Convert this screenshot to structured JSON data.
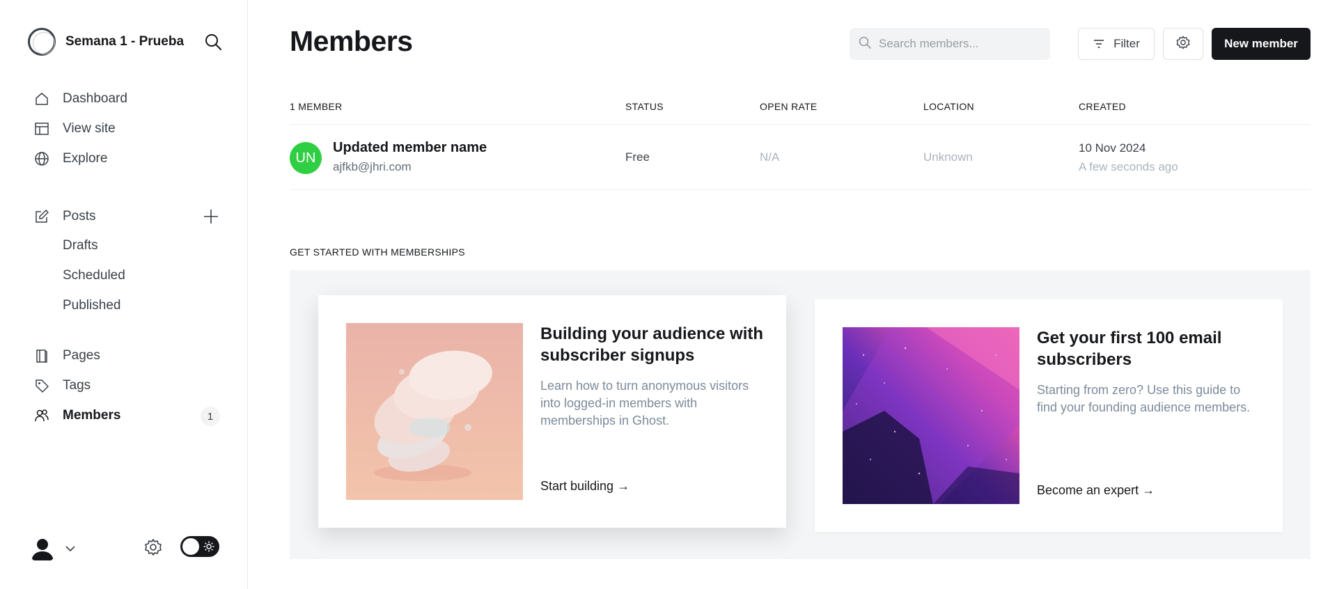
{
  "sidebar": {
    "site_title": "Semana 1 - Prueba",
    "nav": [
      {
        "label": "Dashboard",
        "icon": "home-icon"
      },
      {
        "label": "View site",
        "icon": "layout-icon"
      },
      {
        "label": "Explore",
        "icon": "globe-icon"
      }
    ],
    "posts": {
      "label": "Posts",
      "sub": [
        "Drafts",
        "Scheduled",
        "Published"
      ]
    },
    "nav2": [
      {
        "label": "Pages",
        "icon": "page-icon"
      },
      {
        "label": "Tags",
        "icon": "tag-icon"
      },
      {
        "label": "Members",
        "icon": "members-icon",
        "count": "1",
        "active": true
      }
    ]
  },
  "header": {
    "title": "Members",
    "search_placeholder": "Search members...",
    "filter_label": "Filter",
    "new_member_label": "New member"
  },
  "table": {
    "columns": [
      "1 member",
      "Status",
      "Open rate",
      "Location",
      "Created"
    ],
    "rows": [
      {
        "initials": "UN",
        "name": "Updated member name",
        "email": "ajfkb@jhri.com",
        "status": "Free",
        "open_rate": "N/A",
        "location": "Unknown",
        "created_date": "10 Nov 2024",
        "created_ago": "A few seconds ago"
      }
    ]
  },
  "get_started": {
    "label": "GET STARTED WITH MEMBERSHIPS",
    "cards": [
      {
        "title": "Building your audience with subscriber signups",
        "description": "Learn how to turn anonymous visitors into logged-in members with memberships in Ghost.",
        "link": "Start building →"
      },
      {
        "title": "Get your first 100 email subscribers",
        "description": "Starting from zero? Use this guide to find your founding audience members.",
        "link": "Become an expert →"
      }
    ]
  },
  "colors": {
    "accent": "#15171a",
    "avatar_green": "#30cf43"
  }
}
